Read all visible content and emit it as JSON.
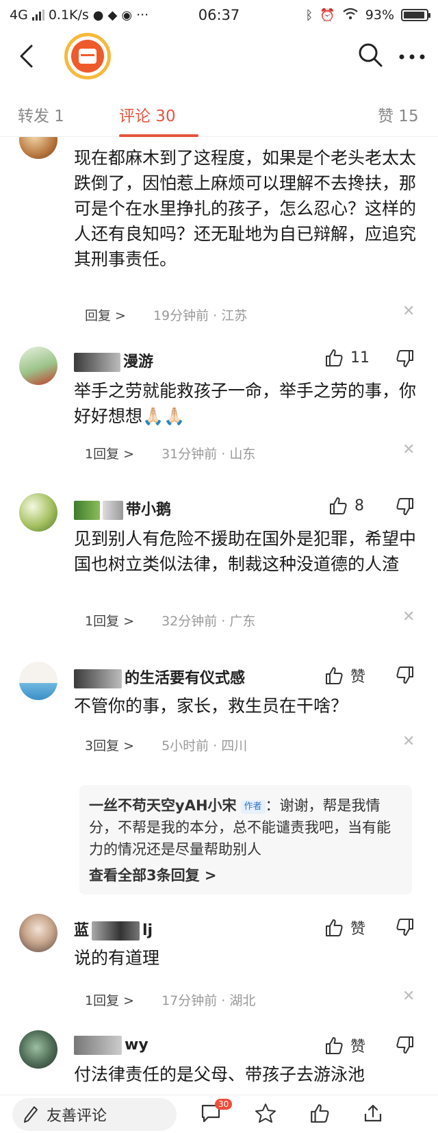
{
  "status_bar": {
    "network": "4G",
    "speed": "0.1K/s",
    "time": "06:37",
    "battery": "93%",
    "battery_level": 0.93
  },
  "tabs": [
    {
      "label": "转发 1"
    },
    {
      "label": "评论 30"
    },
    {
      "label": "赞 15"
    }
  ],
  "comments": [
    {
      "text": "现在都麻木到了这程度，如果是个老头老太太跌倒了，因怕惹上麻烦可以理解不去搀扶，那可是个在水里挣扎的孩子，怎么忍心？这样的人还有良知吗？还无耻地为自已辩解，应追究其刑事责任。",
      "reply": "回复 >",
      "meta": "19分钟前 · 江苏"
    },
    {
      "name": "漫游",
      "likes": "11",
      "text": "举手之劳就能救孩子一命，举手之劳的事，你好好想想🙏🏻🙏🏻",
      "reply": "1回复 >",
      "meta": "31分钟前 · 山东"
    },
    {
      "name": "带小鹅",
      "likes": "8",
      "text": "见到别人有危险不援助在国外是犯罪，希望中国也树立类似法律，制裁这种没道德的人渣",
      "reply": "1回复 >",
      "meta": "32分钟前 · 广东"
    },
    {
      "name": "的生活要有仪式感",
      "likes": "赞",
      "text": "不管你的事，家长，救生员在干啥？",
      "reply": "3回复 >",
      "meta": "5小时前 · 四川",
      "sub_reply": {
        "author": "一丝不苟天空yAH小宋",
        "badge": "作者",
        "text": "：谢谢，帮是我情分，不帮是我的本分，总不能谴责我吧，当有能力的情况还是尽量帮助别人",
        "more": "查看全部3条回复 >"
      }
    },
    {
      "name_a": "蓝",
      "name_b": "lj",
      "likes": "赞",
      "text": "说的有道理",
      "reply": "1回复 >",
      "meta": "17分钟前 · 湖北"
    },
    {
      "name": "wy",
      "likes": "赞",
      "text": "付法律责任的是父母、带孩子去游泳池"
    }
  ],
  "close_glyph": "✕",
  "bottom_bar": {
    "compose_placeholder": "友善评论",
    "comment_count_badge": "30"
  },
  "icons": [
    "back-arrow-icon",
    "search-icon",
    "more-icon",
    "like-icon",
    "dislike-icon",
    "close-icon",
    "pencil-icon",
    "comment-icon",
    "star-icon",
    "thumb-up-icon",
    "share-icon"
  ]
}
